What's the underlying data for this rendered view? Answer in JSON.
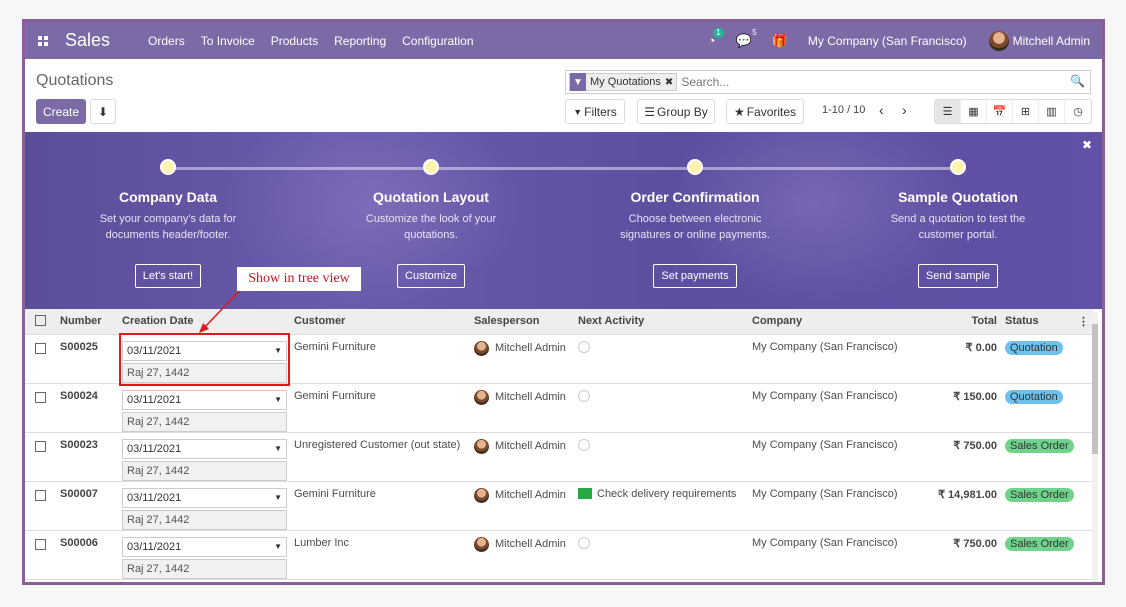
{
  "navbar": {
    "app_title": "Sales",
    "menu": [
      "Orders",
      "To Invoice",
      "Products",
      "Reporting",
      "Configuration"
    ],
    "activity_badge": "1",
    "message_badge": "5",
    "company": "My Company (San Francisco)",
    "user": "Mitchell Admin",
    "brand_color": "#7c6aa6"
  },
  "control_panel": {
    "title": "Quotations",
    "create_label": "Create",
    "facet_label": "My Quotations",
    "search_placeholder": "Search...",
    "filters_label": "Filters",
    "group_by_label": "Group By",
    "favorites_label": "Favorites",
    "pager": "1-10 / 10"
  },
  "banner": {
    "steps": [
      {
        "title": "Company Data",
        "desc1": "Set your company's data for",
        "desc2": "documents header/footer.",
        "button": "Let's start!"
      },
      {
        "title": "Quotation Layout",
        "desc1": "Customize the look of your",
        "desc2": "quotations.",
        "button": "Customize"
      },
      {
        "title": "Order Confirmation",
        "desc1": "Choose between electronic",
        "desc2": "signatures or online payments.",
        "button": "Set payments"
      },
      {
        "title": "Sample Quotation",
        "desc1": "Send a quotation to test the",
        "desc2": "customer portal.",
        "button": "Send sample"
      }
    ]
  },
  "table": {
    "headers": {
      "number": "Number",
      "creation_date": "Creation Date",
      "customer": "Customer",
      "salesperson": "Salesperson",
      "next_activity": "Next Activity",
      "company": "Company",
      "total": "Total",
      "status": "Status"
    },
    "rows": [
      {
        "number": "S00025",
        "date": "03/11/2021",
        "hijri": "Raj 27, 1442",
        "customer": "Gemini Furniture",
        "salesperson": "Mitchell Admin",
        "activity": "",
        "company": "My Company (San Francisco)",
        "total": "₹ 0.00",
        "status": "Quotation"
      },
      {
        "number": "S00024",
        "date": "03/11/2021",
        "hijri": "Raj 27, 1442",
        "customer": "Gemini Furniture",
        "salesperson": "Mitchell Admin",
        "activity": "",
        "company": "My Company (San Francisco)",
        "total": "₹ 150.00",
        "status": "Quotation"
      },
      {
        "number": "S00023",
        "date": "03/11/2021",
        "hijri": "Raj 27, 1442",
        "customer": "Unregistered Customer (out state)",
        "salesperson": "Mitchell Admin",
        "activity": "",
        "company": "My Company (San Francisco)",
        "total": "₹ 750.00",
        "status": "Sales Order"
      },
      {
        "number": "S00007",
        "date": "03/11/2021",
        "hijri": "Raj 27, 1442",
        "customer": "Gemini Furniture",
        "salesperson": "Mitchell Admin",
        "activity": "Check delivery requirements",
        "company": "My Company (San Francisco)",
        "total": "₹ 14,981.00",
        "status": "Sales Order"
      },
      {
        "number": "S00006",
        "date": "03/11/2021",
        "hijri": "Raj 27, 1442",
        "customer": "Lumber Inc",
        "salesperson": "Mitchell Admin",
        "activity": "",
        "company": "My Company (San Francisco)",
        "total": "₹ 750.00",
        "status": "Sales Order"
      }
    ]
  },
  "annotation": {
    "label": "Show in tree view",
    "color": "#e0191b"
  }
}
